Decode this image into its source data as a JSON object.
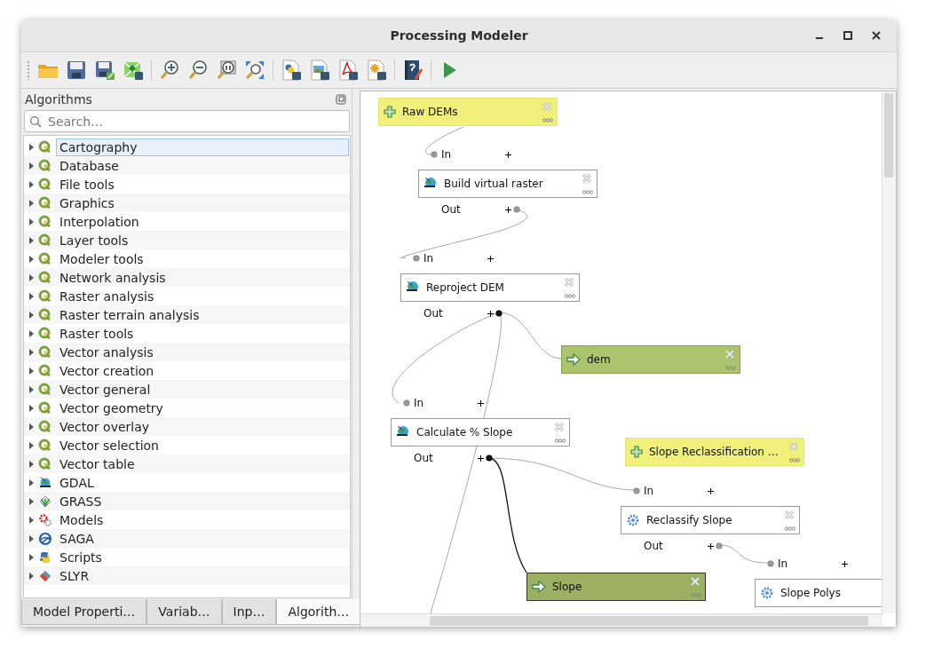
{
  "window": {
    "title": "Processing Modeler"
  },
  "algorithms_panel": {
    "title": "Algorithms",
    "search": {
      "placeholder": "Search…"
    },
    "items": [
      {
        "label": "Cartography",
        "kind": "qgis",
        "selected": true
      },
      {
        "label": "Database",
        "kind": "qgis",
        "selected": false
      },
      {
        "label": "File tools",
        "kind": "qgis",
        "selected": false
      },
      {
        "label": "Graphics",
        "kind": "qgis",
        "selected": false
      },
      {
        "label": "Interpolation",
        "kind": "qgis",
        "selected": false
      },
      {
        "label": "Layer tools",
        "kind": "qgis",
        "selected": false
      },
      {
        "label": "Modeler tools",
        "kind": "qgis",
        "selected": false
      },
      {
        "label": "Network analysis",
        "kind": "qgis",
        "selected": false
      },
      {
        "label": "Raster analysis",
        "kind": "qgis",
        "selected": false
      },
      {
        "label": "Raster terrain analysis",
        "kind": "qgis",
        "selected": false
      },
      {
        "label": "Raster tools",
        "kind": "qgis",
        "selected": false
      },
      {
        "label": "Vector analysis",
        "kind": "qgis",
        "selected": false
      },
      {
        "label": "Vector creation",
        "kind": "qgis",
        "selected": false
      },
      {
        "label": "Vector general",
        "kind": "qgis",
        "selected": false
      },
      {
        "label": "Vector geometry",
        "kind": "qgis",
        "selected": false
      },
      {
        "label": "Vector overlay",
        "kind": "qgis",
        "selected": false
      },
      {
        "label": "Vector selection",
        "kind": "qgis",
        "selected": false
      },
      {
        "label": "Vector table",
        "kind": "qgis",
        "selected": false
      },
      {
        "label": "GDAL",
        "kind": "gdal",
        "selected": false
      },
      {
        "label": "GRASS",
        "kind": "grass",
        "selected": false
      },
      {
        "label": "Models",
        "kind": "models",
        "selected": false
      },
      {
        "label": "SAGA",
        "kind": "saga",
        "selected": false
      },
      {
        "label": "Scripts",
        "kind": "python",
        "selected": false
      },
      {
        "label": "SLYR",
        "kind": "slyr",
        "selected": false
      }
    ],
    "tabs": [
      {
        "label": "Model Properti…",
        "selected": false
      },
      {
        "label": "Variab…",
        "selected": false
      },
      {
        "label": "Inp…",
        "selected": false
      },
      {
        "label": "Algorith…",
        "selected": true
      }
    ]
  },
  "canvas": {
    "nodes": [
      {
        "kind": "input",
        "label": "Raw DEMs",
        "selected": false
      },
      {
        "kind": "gdal",
        "label": "Build virtual raster",
        "in_port": "In",
        "out_port": "Out",
        "linked_output": false,
        "selected": false
      },
      {
        "kind": "gdal",
        "label": "Reproject DEM",
        "in_port": "In",
        "out_port": "Out",
        "linked_output": true,
        "selected": false
      },
      {
        "kind": "output",
        "label": "dem",
        "selected": false
      },
      {
        "kind": "gdal",
        "label": "Calculate % Slope",
        "in_port": "In",
        "out_port": "Out",
        "linked_output": true,
        "selected": false
      },
      {
        "kind": "input",
        "label": "Slope Reclassification …",
        "selected": false
      },
      {
        "kind": "native",
        "label": "Reclassify Slope",
        "in_port": "In",
        "out_port": "Out",
        "linked_output": false,
        "selected": false
      },
      {
        "kind": "output",
        "label": "Slope",
        "selected": true
      },
      {
        "kind": "native",
        "label": "Slope Polys",
        "in_port": "In",
        "selected": false
      }
    ]
  }
}
